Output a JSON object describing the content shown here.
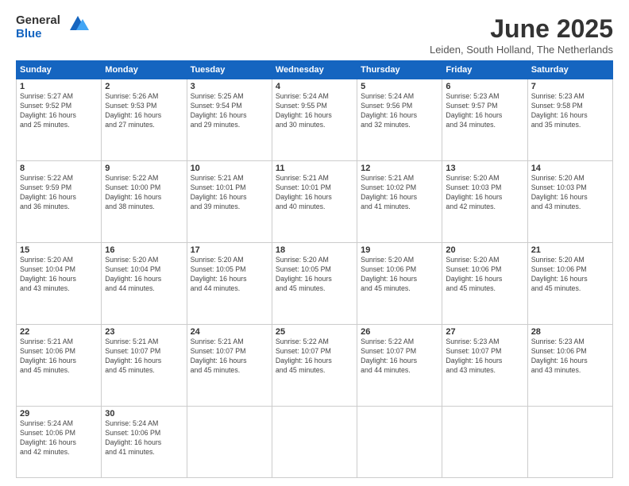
{
  "header": {
    "logo_general": "General",
    "logo_blue": "Blue",
    "month": "June 2025",
    "location": "Leiden, South Holland, The Netherlands"
  },
  "weekdays": [
    "Sunday",
    "Monday",
    "Tuesday",
    "Wednesday",
    "Thursday",
    "Friday",
    "Saturday"
  ],
  "weeks": [
    [
      {
        "day": "1",
        "info": "Sunrise: 5:27 AM\nSunset: 9:52 PM\nDaylight: 16 hours\nand 25 minutes."
      },
      {
        "day": "2",
        "info": "Sunrise: 5:26 AM\nSunset: 9:53 PM\nDaylight: 16 hours\nand 27 minutes."
      },
      {
        "day": "3",
        "info": "Sunrise: 5:25 AM\nSunset: 9:54 PM\nDaylight: 16 hours\nand 29 minutes."
      },
      {
        "day": "4",
        "info": "Sunrise: 5:24 AM\nSunset: 9:55 PM\nDaylight: 16 hours\nand 30 minutes."
      },
      {
        "day": "5",
        "info": "Sunrise: 5:24 AM\nSunset: 9:56 PM\nDaylight: 16 hours\nand 32 minutes."
      },
      {
        "day": "6",
        "info": "Sunrise: 5:23 AM\nSunset: 9:57 PM\nDaylight: 16 hours\nand 34 minutes."
      },
      {
        "day": "7",
        "info": "Sunrise: 5:23 AM\nSunset: 9:58 PM\nDaylight: 16 hours\nand 35 minutes."
      }
    ],
    [
      {
        "day": "8",
        "info": "Sunrise: 5:22 AM\nSunset: 9:59 PM\nDaylight: 16 hours\nand 36 minutes."
      },
      {
        "day": "9",
        "info": "Sunrise: 5:22 AM\nSunset: 10:00 PM\nDaylight: 16 hours\nand 38 minutes."
      },
      {
        "day": "10",
        "info": "Sunrise: 5:21 AM\nSunset: 10:01 PM\nDaylight: 16 hours\nand 39 minutes."
      },
      {
        "day": "11",
        "info": "Sunrise: 5:21 AM\nSunset: 10:01 PM\nDaylight: 16 hours\nand 40 minutes."
      },
      {
        "day": "12",
        "info": "Sunrise: 5:21 AM\nSunset: 10:02 PM\nDaylight: 16 hours\nand 41 minutes."
      },
      {
        "day": "13",
        "info": "Sunrise: 5:20 AM\nSunset: 10:03 PM\nDaylight: 16 hours\nand 42 minutes."
      },
      {
        "day": "14",
        "info": "Sunrise: 5:20 AM\nSunset: 10:03 PM\nDaylight: 16 hours\nand 43 minutes."
      }
    ],
    [
      {
        "day": "15",
        "info": "Sunrise: 5:20 AM\nSunset: 10:04 PM\nDaylight: 16 hours\nand 43 minutes."
      },
      {
        "day": "16",
        "info": "Sunrise: 5:20 AM\nSunset: 10:04 PM\nDaylight: 16 hours\nand 44 minutes."
      },
      {
        "day": "17",
        "info": "Sunrise: 5:20 AM\nSunset: 10:05 PM\nDaylight: 16 hours\nand 44 minutes."
      },
      {
        "day": "18",
        "info": "Sunrise: 5:20 AM\nSunset: 10:05 PM\nDaylight: 16 hours\nand 45 minutes."
      },
      {
        "day": "19",
        "info": "Sunrise: 5:20 AM\nSunset: 10:06 PM\nDaylight: 16 hours\nand 45 minutes."
      },
      {
        "day": "20",
        "info": "Sunrise: 5:20 AM\nSunset: 10:06 PM\nDaylight: 16 hours\nand 45 minutes."
      },
      {
        "day": "21",
        "info": "Sunrise: 5:20 AM\nSunset: 10:06 PM\nDaylight: 16 hours\nand 45 minutes."
      }
    ],
    [
      {
        "day": "22",
        "info": "Sunrise: 5:21 AM\nSunset: 10:06 PM\nDaylight: 16 hours\nand 45 minutes."
      },
      {
        "day": "23",
        "info": "Sunrise: 5:21 AM\nSunset: 10:07 PM\nDaylight: 16 hours\nand 45 minutes."
      },
      {
        "day": "24",
        "info": "Sunrise: 5:21 AM\nSunset: 10:07 PM\nDaylight: 16 hours\nand 45 minutes."
      },
      {
        "day": "25",
        "info": "Sunrise: 5:22 AM\nSunset: 10:07 PM\nDaylight: 16 hours\nand 45 minutes."
      },
      {
        "day": "26",
        "info": "Sunrise: 5:22 AM\nSunset: 10:07 PM\nDaylight: 16 hours\nand 44 minutes."
      },
      {
        "day": "27",
        "info": "Sunrise: 5:23 AM\nSunset: 10:07 PM\nDaylight: 16 hours\nand 43 minutes."
      },
      {
        "day": "28",
        "info": "Sunrise: 5:23 AM\nSunset: 10:06 PM\nDaylight: 16 hours\nand 43 minutes."
      }
    ],
    [
      {
        "day": "29",
        "info": "Sunrise: 5:24 AM\nSunset: 10:06 PM\nDaylight: 16 hours\nand 42 minutes."
      },
      {
        "day": "30",
        "info": "Sunrise: 5:24 AM\nSunset: 10:06 PM\nDaylight: 16 hours\nand 41 minutes."
      },
      {
        "day": "",
        "info": ""
      },
      {
        "day": "",
        "info": ""
      },
      {
        "day": "",
        "info": ""
      },
      {
        "day": "",
        "info": ""
      },
      {
        "day": "",
        "info": ""
      }
    ]
  ]
}
